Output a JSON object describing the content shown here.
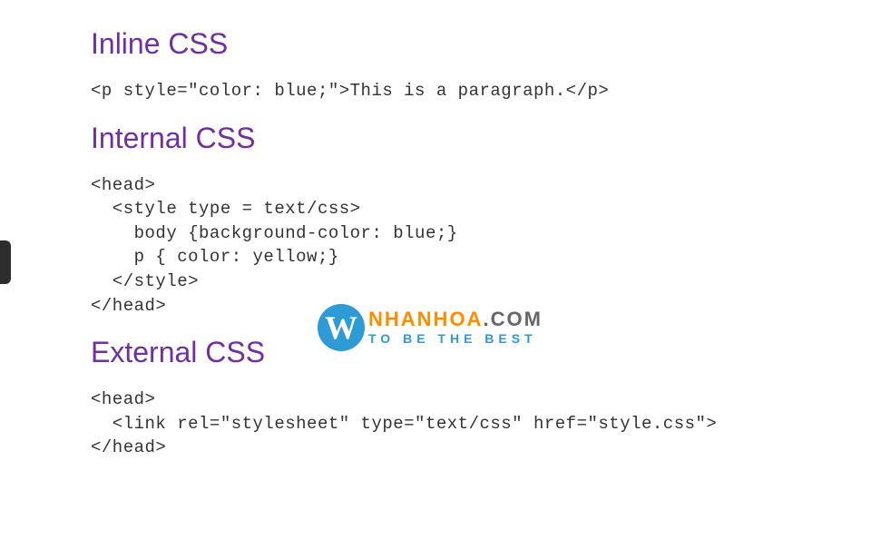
{
  "sections": {
    "inline": {
      "title": "Inline CSS",
      "code": "<p style=\"color: blue;\">This is a paragraph.</p>"
    },
    "internal": {
      "title": "Internal CSS",
      "code": "<head>\n  <style type = text/css>\n    body {background-color: blue;}\n    p { color: yellow;}\n  </style>\n</head>"
    },
    "external": {
      "title": "External CSS",
      "code": "<head>\n  <link rel=\"stylesheet\" type=\"text/css\" href=\"style.css\">\n</head>"
    }
  },
  "watermark": {
    "letter": "W",
    "brand": "NHANHOA",
    "domain": ".COM",
    "tagline": "TO BE THE BEST"
  }
}
